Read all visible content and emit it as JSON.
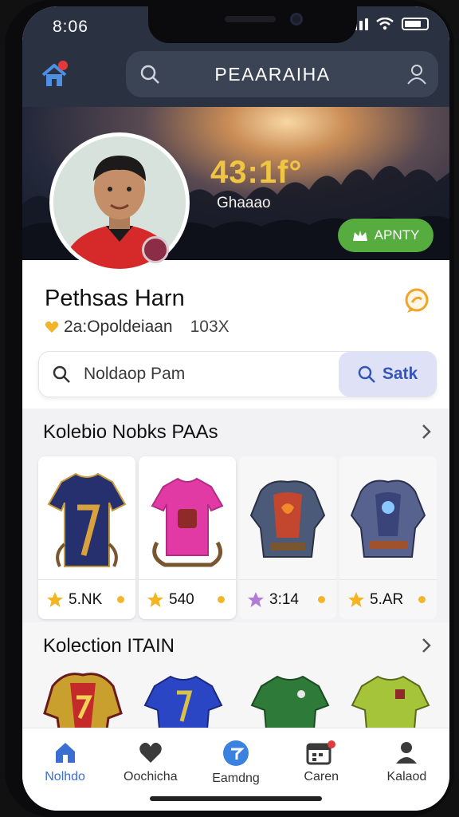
{
  "status_bar": {
    "time": "8:06"
  },
  "header": {
    "title": "PEAARAIHA"
  },
  "banner": {
    "score": "43:1f°",
    "score_sub": "Ghaaao",
    "activity_button": "APNTY"
  },
  "profile": {
    "name": "Pethsas Harn",
    "subtitle": "2a:Opoldeiaan",
    "percent": "103X"
  },
  "search": {
    "placeholder": "Noldaop Pam",
    "button_label": "Satk"
  },
  "collection1": {
    "title": "Kolebio Nobks PAAs",
    "items": [
      {
        "art": "jersey-navy-icon",
        "star": "gold",
        "value": "5.NK"
      },
      {
        "art": "jersey-pink-icon",
        "star": "gold",
        "value": "540"
      },
      {
        "art": "armor-red-icon",
        "star": "purple",
        "value": "3:14"
      },
      {
        "art": "armor-blue-icon",
        "star": "gold",
        "value": "5.AR"
      }
    ]
  },
  "collection2": {
    "title": "Kolection ITAIN",
    "items": [
      {
        "art": "armor-gold-icon"
      },
      {
        "art": "jersey-blue-icon"
      },
      {
        "art": "jersey-green-icon"
      },
      {
        "art": "jersey-lime-icon"
      }
    ]
  },
  "nav": [
    {
      "label": "Nolhdo",
      "icon": "home-icon",
      "active": true
    },
    {
      "label": "Oochicha",
      "icon": "heart-icon",
      "active": false
    },
    {
      "label": "Eamdng",
      "icon": "compass-icon",
      "active": false
    },
    {
      "label": "Caren",
      "icon": "calendar-icon",
      "active": false
    },
    {
      "label": "Kalaod",
      "icon": "profile-icon",
      "active": false
    }
  ],
  "colors": {
    "accent": "#3a6ed0",
    "header": "#2a3242",
    "success": "#56ac3f",
    "score": "#f0c541"
  }
}
